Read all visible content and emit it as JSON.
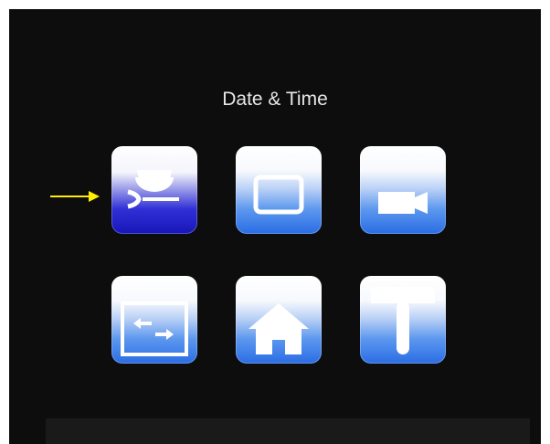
{
  "screen": {
    "title": "Date & Time"
  },
  "menu": {
    "selected_index": 0,
    "selector_color": "#ffee00",
    "items": [
      {
        "icon": "wrench-settings-icon",
        "selected": true
      },
      {
        "icon": "tv-display-icon",
        "selected": false
      },
      {
        "icon": "video-camera-icon",
        "selected": false
      },
      {
        "icon": "switch-arrows-icon",
        "selected": false
      },
      {
        "icon": "home-icon",
        "selected": false
      },
      {
        "icon": "tool-handle-icon",
        "selected": false
      }
    ]
  }
}
